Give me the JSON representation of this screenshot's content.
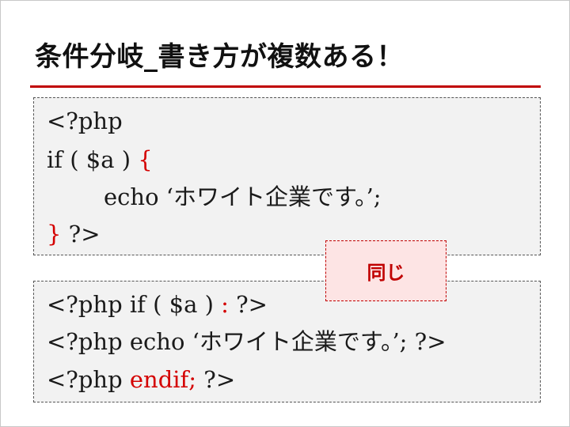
{
  "slide": {
    "title": "条件分岐_書き方が複数ある！",
    "accent_color": "#c00000",
    "badge_label": "同じ"
  },
  "code_block_1": {
    "line1": "<?php",
    "line2_pre": "if ( $a ) ",
    "line2_brace": "{",
    "line3": "echo ‘ホワイト企業です。’;",
    "line4_brace": "}",
    "line4_post": " ?>"
  },
  "code_block_2": {
    "line1_pre": "<?php if ( $a ) ",
    "line1_colon": ":",
    "line1_post": " ?>",
    "line2": "<?php echo ‘ホワイト企業です。’; ?>",
    "line3_pre": "<?php ",
    "line3_endif": "endif;",
    "line3_post": " ?>"
  }
}
